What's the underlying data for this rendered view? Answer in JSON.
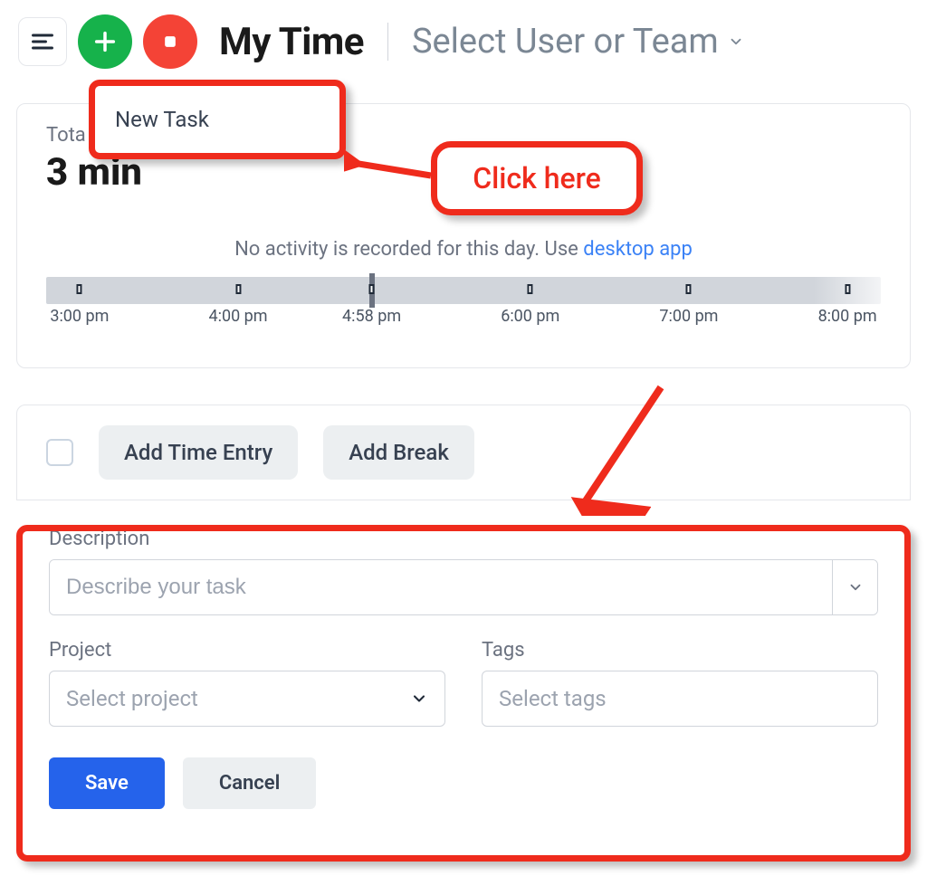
{
  "header": {
    "page_title": "My Time",
    "user_selector": "Select User or Team"
  },
  "dropdown": {
    "new_task": "New Task"
  },
  "annotation": {
    "click_here": "Click here"
  },
  "summary": {
    "total_label": "Tota",
    "total_value": "3 min",
    "no_activity_prefix": "No activity is recorded for this day. Use ",
    "no_activity_link": "desktop app"
  },
  "timeline": {
    "ticks": [
      "3:00 pm",
      "4:00 pm",
      "4:58 pm",
      "6:00 pm",
      "7:00 pm",
      "8:00 pm"
    ],
    "positions_pct": [
      4,
      23,
      39,
      58,
      77,
      96
    ],
    "current_pct": 39
  },
  "actions": {
    "add_time_entry": "Add Time Entry",
    "add_break": "Add Break"
  },
  "form": {
    "description_label": "Description",
    "description_placeholder": "Describe your task",
    "project_label": "Project",
    "project_placeholder": "Select project",
    "tags_label": "Tags",
    "tags_placeholder": "Select tags",
    "save": "Save",
    "cancel": "Cancel"
  }
}
